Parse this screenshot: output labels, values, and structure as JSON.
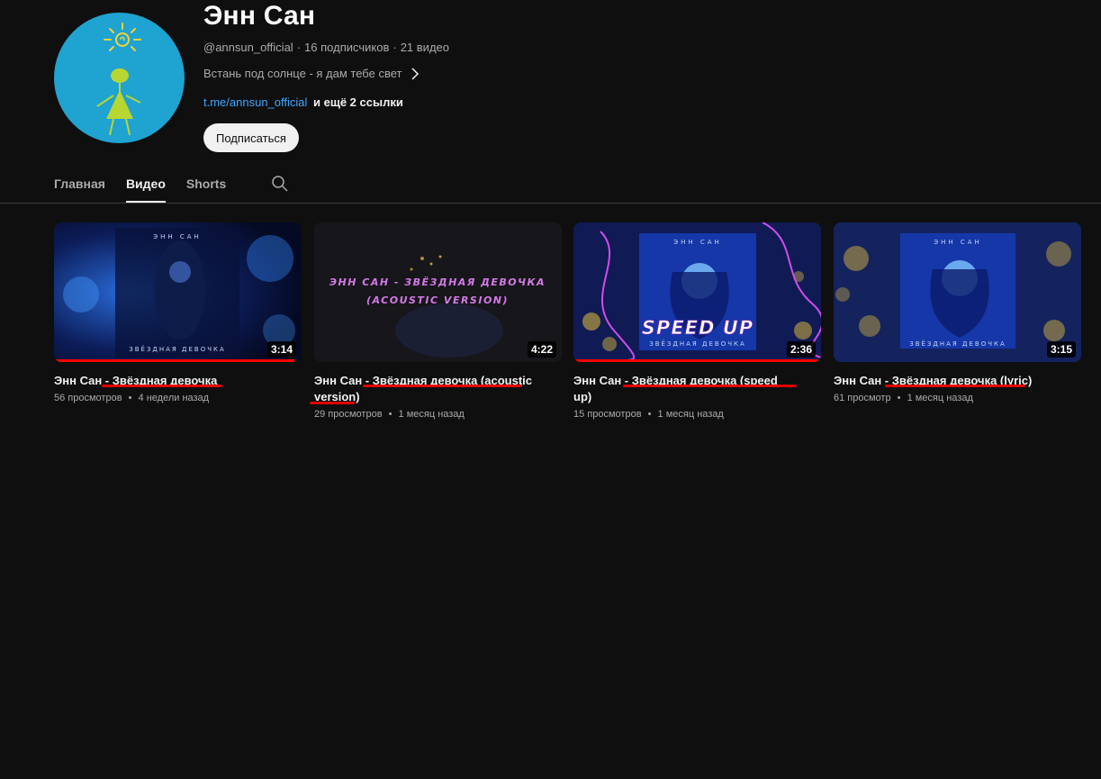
{
  "channel": {
    "title": "Энн Сан",
    "handle": "@annsun_official",
    "subscribers": "16 подписчиков",
    "videos_count": "21 видео",
    "description": "Встань под солнце - я дам тебе свет",
    "link": "t.me/annsun_official",
    "more_links": "и ещё 2 ссылки",
    "subscribe_label": "Подписаться"
  },
  "tabs": [
    {
      "label": "Главная"
    },
    {
      "label": "Видео"
    },
    {
      "label": "Shorts"
    }
  ],
  "active_tab": "Видео",
  "videos": [
    {
      "title": "Энн Сан - Звёздная девочка",
      "views": "56 просмотров",
      "age": "4 недели назад",
      "duration": "3:14",
      "watched_fraction": 0.97,
      "thumb_text_top": "ЭНН САН",
      "thumb_text_bottom": "ЗВЁЗДНАЯ ДЕВОЧКА"
    },
    {
      "title": "Энн Сан - Звёздная девочка (acoustic version)",
      "views": "29 просмотров",
      "age": "1 месяц назад",
      "duration": "4:22",
      "watched_fraction": 0,
      "thumb_text_top": "ЭНН САН - ЗВЁЗДНАЯ ДЕВОЧКА",
      "thumb_text_bottom": "(ACOUSTIC VERSION)"
    },
    {
      "title": "Энн Сан - Звёздная девочка (speed up)",
      "views": "15 просмотров",
      "age": "1 месяц назад",
      "duration": "2:36",
      "watched_fraction": 0.99,
      "thumb_text_top": "ЭНН САН",
      "thumb_text_bottom": "ЗВЁЗДНАЯ ДЕВОЧКА",
      "thumb_overlay": "SPEED UP"
    },
    {
      "title": "Энн Сан - Звёздная девочка (lyric)",
      "views": "61 просмотр",
      "age": "1 месяц назад",
      "duration": "3:15",
      "watched_fraction": 0,
      "thumb_text_top": "ЭНН САН",
      "thumb_text_bottom": "ЗВЁЗДНАЯ ДЕВОЧКА"
    }
  ],
  "colors": {
    "background": "#0f0f0f",
    "link": "#3ea6ff",
    "progress": "#ff0000",
    "annotation_underline": "#e00000",
    "avatar_bg": "#1fa3d0"
  }
}
